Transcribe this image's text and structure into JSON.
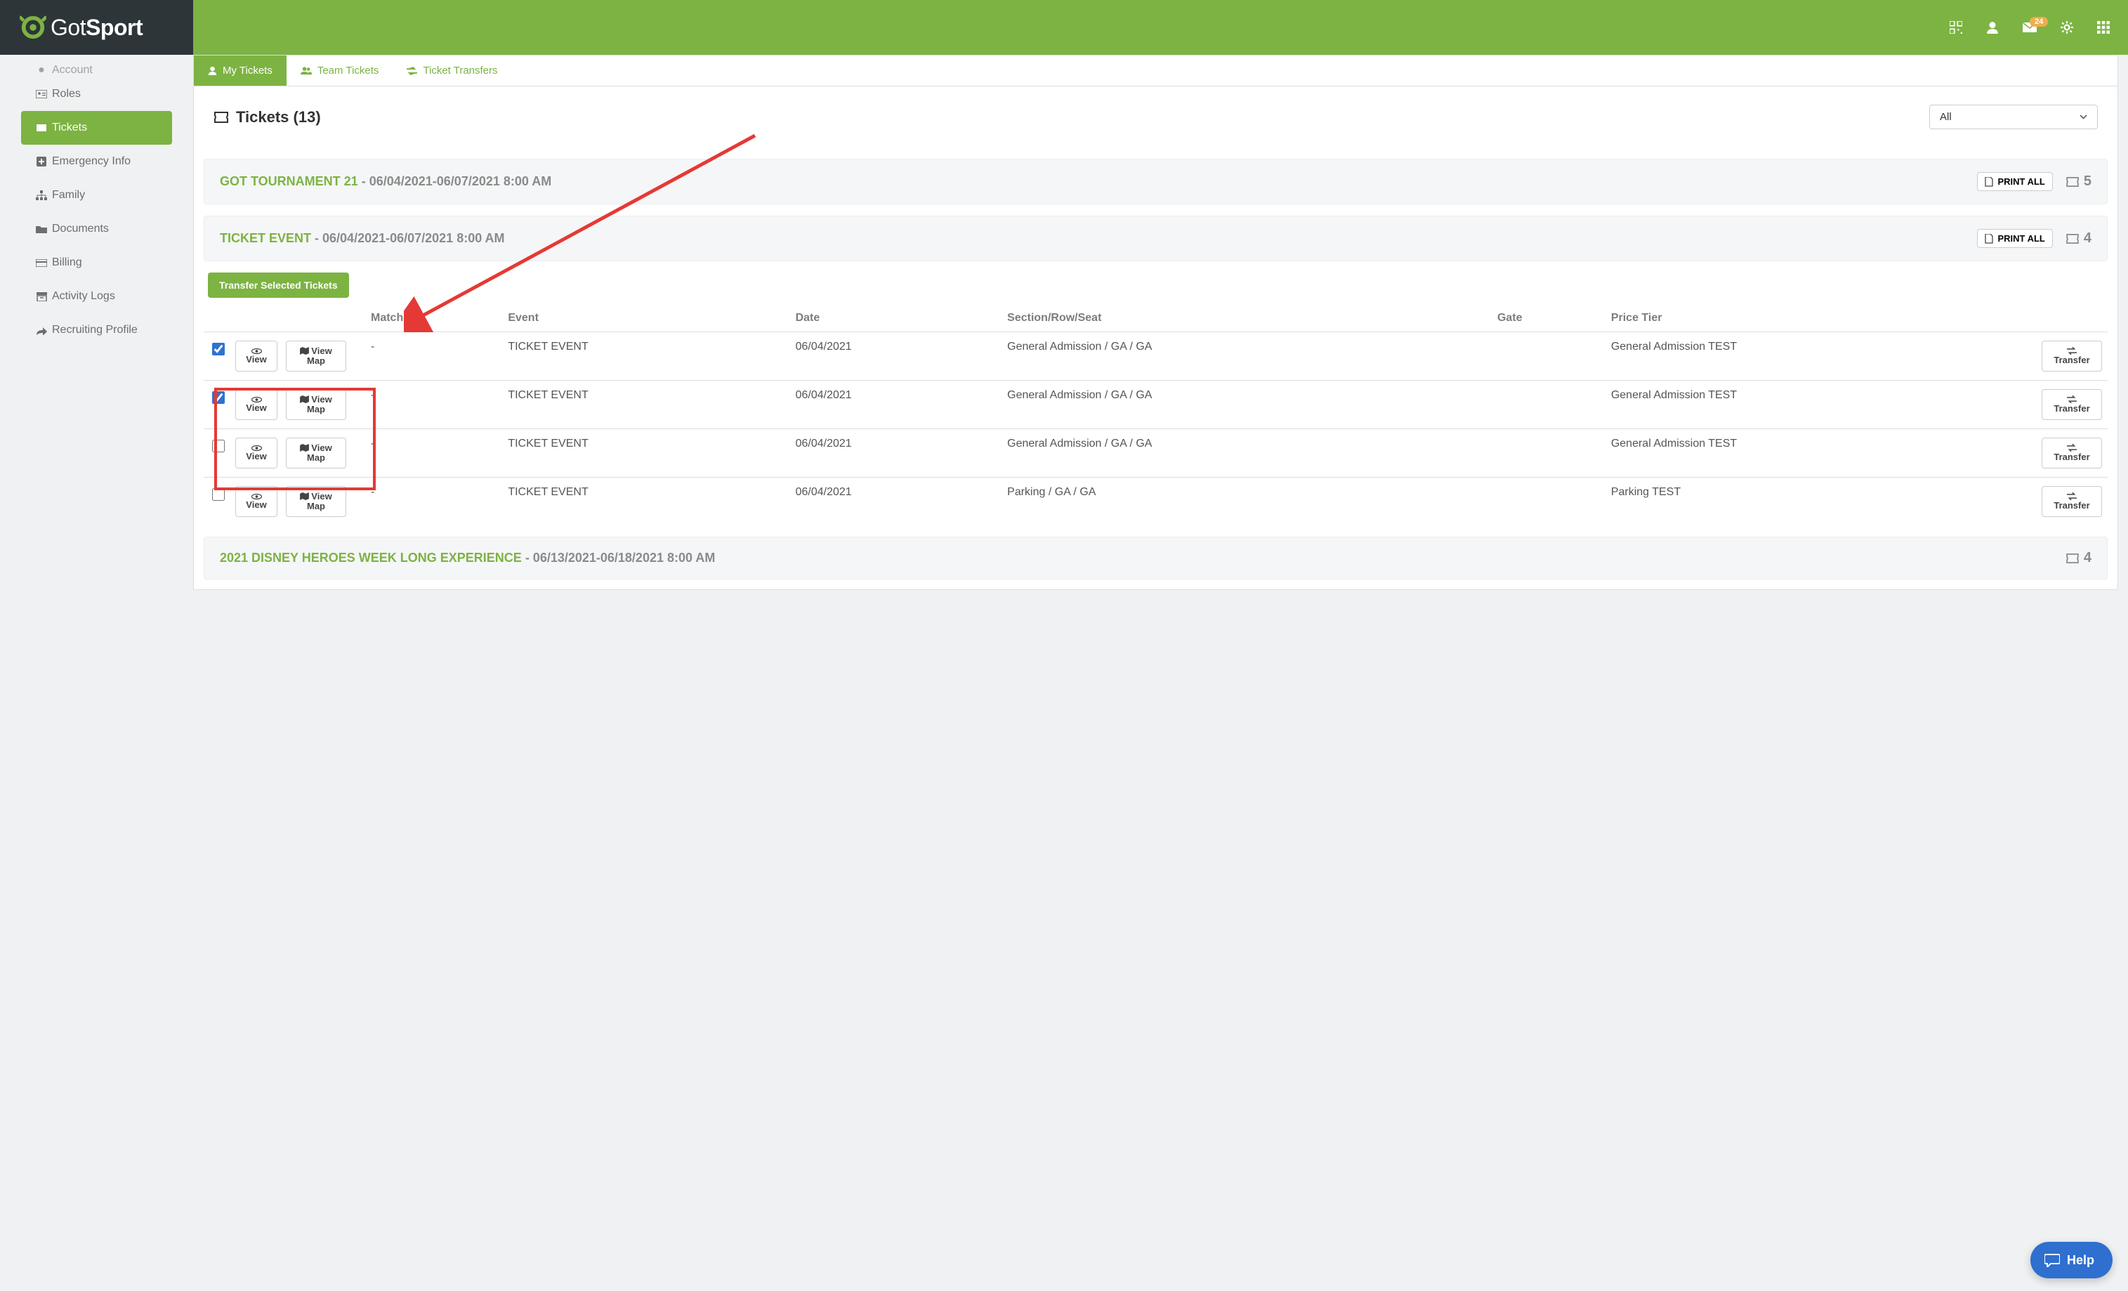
{
  "topbar": {
    "notification_count": "24"
  },
  "brand": {
    "first": "Got",
    "second": "Sport"
  },
  "sidebar": {
    "items": [
      {
        "label": "Account"
      },
      {
        "label": "Roles"
      },
      {
        "label": "Tickets"
      },
      {
        "label": "Emergency Info"
      },
      {
        "label": "Family"
      },
      {
        "label": "Documents"
      },
      {
        "label": "Billing"
      },
      {
        "label": "Activity Logs"
      },
      {
        "label": "Recruiting Profile"
      }
    ]
  },
  "tabs": {
    "my_tickets": "My Tickets",
    "team_tickets": "Team Tickets",
    "ticket_transfers": "Ticket Transfers"
  },
  "page": {
    "title": "Tickets (13)",
    "filter_selected": "All"
  },
  "buttons": {
    "print_all": "PRINT ALL",
    "transfer_selected": "Transfer Selected Tickets",
    "view": "View",
    "view_map": "View Map",
    "transfer": "Transfer",
    "help": "Help"
  },
  "table_head": {
    "match": "Match",
    "event": "Event",
    "date": "Date",
    "section": "Section/Row/Seat",
    "gate": "Gate",
    "price_tier": "Price Tier"
  },
  "groups": [
    {
      "event": "GOT TOURNAMENT 21",
      "date_range": "06/04/2021-06/07/2021 8:00 AM",
      "count": "5"
    },
    {
      "event": "TICKET EVENT",
      "date_range": "06/04/2021-06/07/2021 8:00 AM",
      "count": "4",
      "rows": [
        {
          "checked": true,
          "match": "-",
          "event": "TICKET EVENT",
          "date": "06/04/2021",
          "section": "General Admission / GA / GA",
          "gate": "",
          "price_tier": "General Admission TEST"
        },
        {
          "checked": true,
          "match": "-",
          "event": "TICKET EVENT",
          "date": "06/04/2021",
          "section": "General Admission / GA / GA",
          "gate": "",
          "price_tier": "General Admission TEST"
        },
        {
          "checked": false,
          "match": "-",
          "event": "TICKET EVENT",
          "date": "06/04/2021",
          "section": "General Admission / GA / GA",
          "gate": "",
          "price_tier": "General Admission TEST"
        },
        {
          "checked": false,
          "match": "-",
          "event": "TICKET EVENT",
          "date": "06/04/2021",
          "section": "Parking / GA / GA",
          "gate": "",
          "price_tier": "Parking TEST"
        }
      ]
    },
    {
      "event": "2021 DISNEY HEROES WEEK LONG EXPERIENCE",
      "date_range": "06/13/2021-06/18/2021 8:00 AM",
      "count": "4"
    }
  ]
}
